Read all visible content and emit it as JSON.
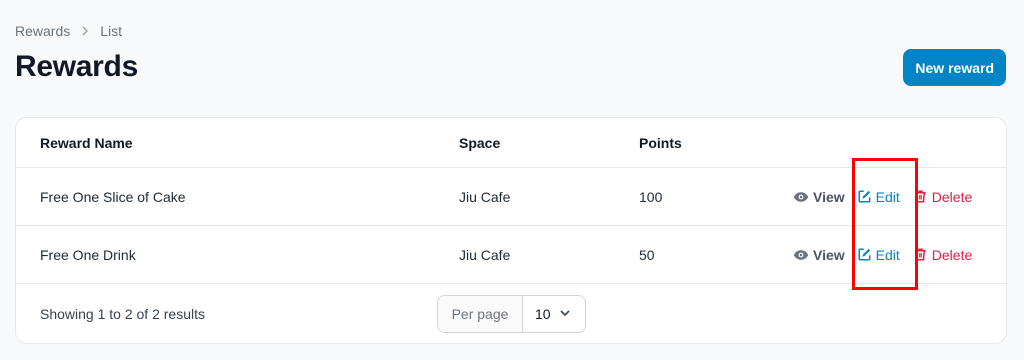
{
  "breadcrumb": {
    "items": [
      "Rewards",
      "List"
    ],
    "separator": ">"
  },
  "page": {
    "title": "Rewards",
    "new_button": "New reward"
  },
  "table": {
    "headers": [
      "Reward Name",
      "Space",
      "Points"
    ],
    "rows": [
      {
        "name": "Free One Slice of Cake",
        "space": "Jiu Cafe",
        "points": "100"
      },
      {
        "name": "Free One Drink",
        "space": "Jiu Cafe",
        "points": "50"
      }
    ],
    "actions": {
      "view": "View",
      "edit": "Edit",
      "delete": "Delete"
    },
    "footer": {
      "showing": "Showing 1 to 2 of 2 results",
      "per_page_label": "Per page",
      "per_page_value": "10"
    }
  },
  "colors": {
    "primary": "#0284c7",
    "danger": "#e11d48",
    "highlight": "#ff0000"
  },
  "icons": {
    "view": "eye-icon",
    "edit": "pencil-square-icon",
    "delete": "trash-icon",
    "breadcrumb_sep": "chevron-right-icon",
    "select": "chevron-down-icon"
  }
}
